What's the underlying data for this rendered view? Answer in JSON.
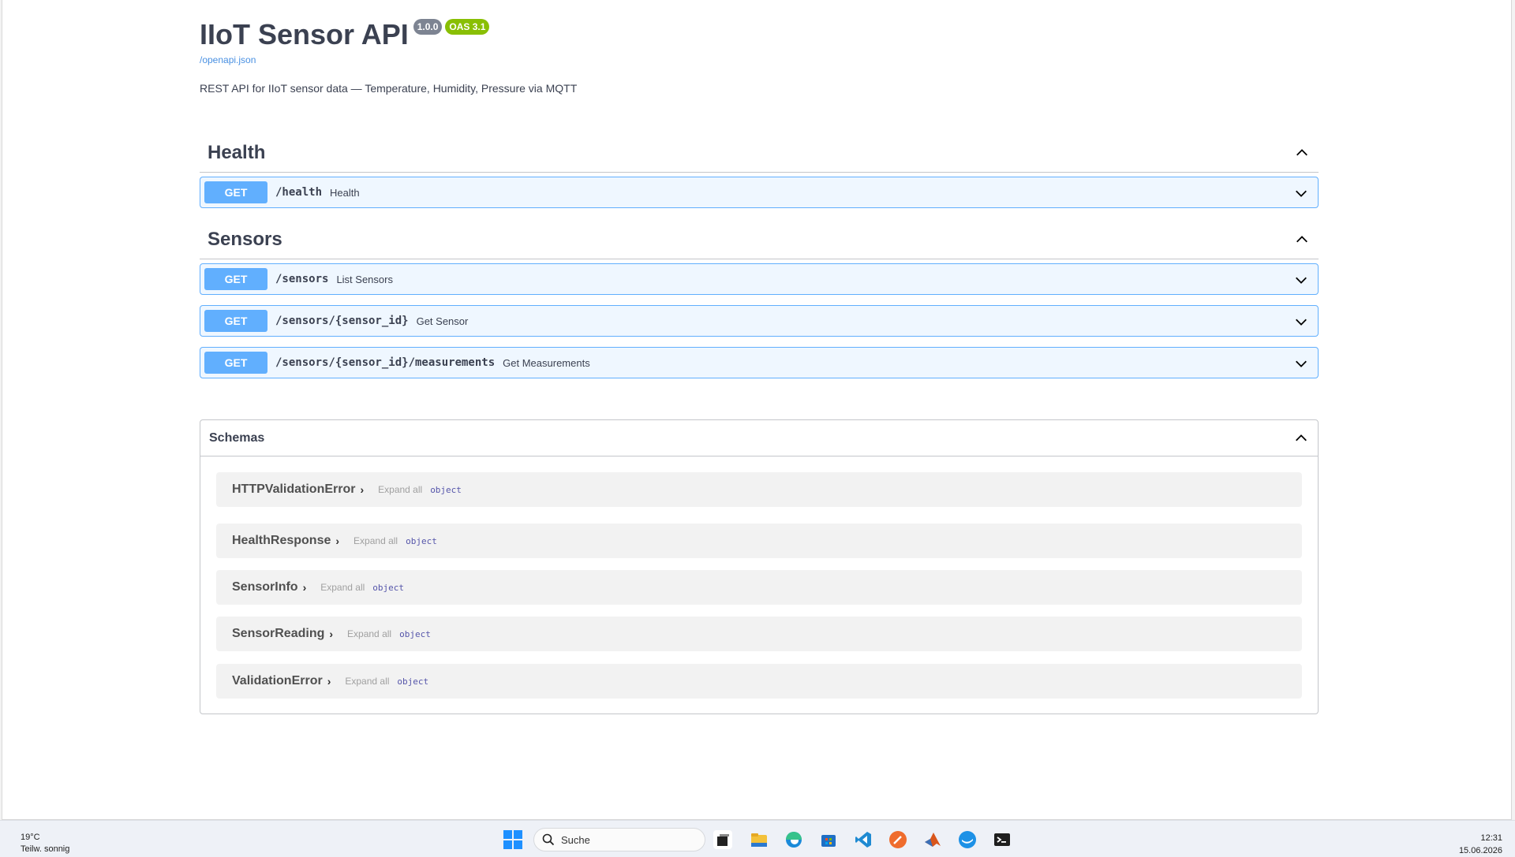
{
  "header": {
    "title": "IIoT Sensor API",
    "version_badge": "1.0.0",
    "oas_badge": "OAS 3.1",
    "spec_link": "/openapi.json",
    "description": "REST API for IIoT sensor data — Temperature, Humidity, Pressure via MQTT"
  },
  "tags": [
    {
      "name": "Health",
      "operations": [
        {
          "method": "GET",
          "path": "/health",
          "summary": "Health"
        }
      ]
    },
    {
      "name": "Sensors",
      "operations": [
        {
          "method": "GET",
          "path": "/sensors",
          "summary": "List Sensors"
        },
        {
          "method": "GET",
          "path": "/sensors/{sensor_id}",
          "summary": "Get Sensor"
        },
        {
          "method": "GET",
          "path": "/sensors/{sensor_id}/measurements",
          "summary": "Get Measurements"
        }
      ]
    }
  ],
  "schemas": {
    "title": "Schemas",
    "expand_label": "Expand all",
    "items": [
      {
        "name": "HTTPValidationError",
        "type": "object"
      },
      {
        "name": "HealthResponse",
        "type": "object"
      },
      {
        "name": "SensorInfo",
        "type": "object"
      },
      {
        "name": "SensorReading",
        "type": "object"
      },
      {
        "name": "ValidationError",
        "type": "object"
      }
    ]
  },
  "taskbar": {
    "weather_temp": "19°C",
    "weather_desc": "Teilw. sonnig",
    "search_placeholder": "Suche",
    "time": "12:31",
    "date": "15.06.2026",
    "apps": [
      "task-view-icon",
      "file-explorer-icon",
      "edge-browser-icon",
      "store-icon",
      "vscode-icon",
      "postman-icon",
      "matlab-icon",
      "docker-icon",
      "terminal-icon"
    ]
  },
  "colors": {
    "get_method": "#61affe",
    "oas_badge": "#89bf04",
    "version_badge": "#7d8492",
    "link": "#4990e2"
  }
}
